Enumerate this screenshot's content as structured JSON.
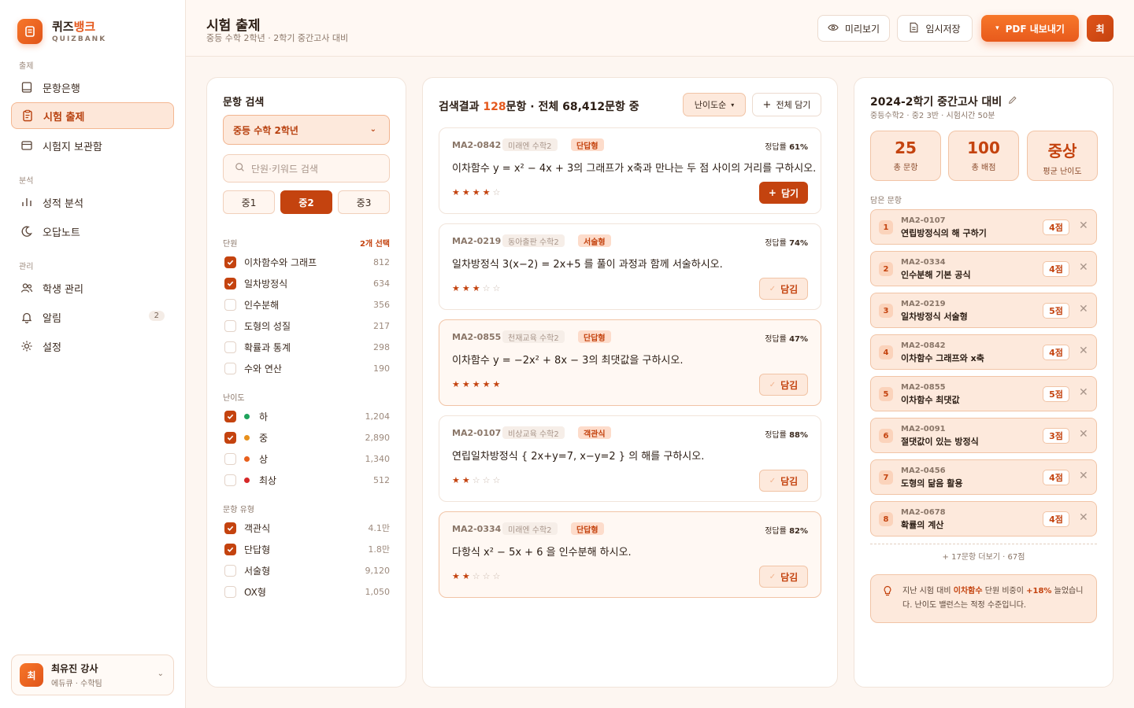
{
  "brand": {
    "name_prefix": "퀴즈",
    "name_accent": "뱅크",
    "sub": "QUIZBANK"
  },
  "sidebar": {
    "sections": {
      "create": "출제",
      "analysis": "분석",
      "manage": "관리"
    },
    "items": [
      {
        "label": "문항은행",
        "icon": "book-icon"
      },
      {
        "label": "시험 출제",
        "icon": "clipboard-icon"
      },
      {
        "label": "시험지 보관함",
        "icon": "archive-icon"
      },
      {
        "label": "성적 분석",
        "icon": "bar-chart-icon"
      },
      {
        "label": "오답노트",
        "icon": "moon-icon"
      },
      {
        "label": "학생 관리",
        "icon": "users-icon"
      },
      {
        "label": "알림",
        "icon": "bell-icon",
        "badge": "2"
      },
      {
        "label": "설정",
        "icon": "gear-icon"
      }
    ],
    "user": {
      "initial": "최",
      "name": "최유진 강사",
      "role": "에듀큐 · 수학팀"
    }
  },
  "header": {
    "title": "시험 출제",
    "subtitle": "중등 수학 2학년 · 2학기 중간고사 대비",
    "preview": "미리보기",
    "save": "임시저장",
    "export": "PDF 내보내기",
    "avatar": "최"
  },
  "search_panel": {
    "title": "문항 검색",
    "grade_select": "중등 수학 2학년",
    "search_placeholder": "단원·키워드 검색",
    "grades": [
      "중1",
      "중2",
      "중3"
    ],
    "active_grade": "중2",
    "units_label": "단원",
    "units_selected": "2개 선택",
    "units": [
      {
        "label": "이차함수와 그래프",
        "count": "812",
        "checked": true
      },
      {
        "label": "일차방정식",
        "count": "634",
        "checked": true
      },
      {
        "label": "인수분해",
        "count": "356",
        "checked": false
      },
      {
        "label": "도형의 성질",
        "count": "217",
        "checked": false
      },
      {
        "label": "확률과 통계",
        "count": "298",
        "checked": false
      },
      {
        "label": "수와 연산",
        "count": "190",
        "checked": false
      }
    ],
    "difficulty_label": "난이도",
    "difficulties": [
      {
        "label": "하",
        "count": "1,204",
        "checked": true,
        "color": "#1fa35c"
      },
      {
        "label": "중",
        "count": "2,890",
        "checked": true,
        "color": "#e8901c"
      },
      {
        "label": "상",
        "count": "1,340",
        "checked": false,
        "color": "#e8601c"
      },
      {
        "label": "최상",
        "count": "512",
        "checked": false,
        "color": "#d62828"
      }
    ],
    "type_label": "문항 유형",
    "types": [
      {
        "label": "객관식",
        "count": "4.1만",
        "checked": true
      },
      {
        "label": "단답형",
        "count": "1.8만",
        "checked": true
      },
      {
        "label": "서술형",
        "count": "9,120",
        "checked": false
      },
      {
        "label": "OX형",
        "count": "1,050",
        "checked": false
      }
    ]
  },
  "results": {
    "prefix": "검색결과 ",
    "count": "128",
    "suffix": "문항 · 전체 68,412문항 중",
    "sort_label": "난이도순",
    "add_all_label": "전체 담기",
    "rate_label": "정답률",
    "add_label": "담기",
    "added_label": "담김",
    "questions": [
      {
        "code": "MA2-0842",
        "publisher": "미래엔 수학2",
        "type": "단답형",
        "rate": "61%",
        "text": "이차함수 y = x² − 4x + 3의 그래프가 x축과 만나는 두 점 사이의 거리를 구하시오.",
        "stars": 4,
        "added": false
      },
      {
        "code": "MA2-0219",
        "publisher": "동아출판 수학2",
        "type": "서술형",
        "rate": "74%",
        "text": "일차방정식 3(x−2) = 2x+5 를 풀이 과정과 함께 서술하시오.",
        "stars": 3,
        "added": true
      },
      {
        "code": "MA2-0855",
        "publisher": "천재교육 수학2",
        "type": "단답형",
        "rate": "47%",
        "text": "이차함수 y = −2x² + 8x − 3의 최댓값을 구하시오.",
        "stars": 5,
        "added": true
      },
      {
        "code": "MA2-0107",
        "publisher": "비상교육 수학2",
        "type": "객관식",
        "rate": "88%",
        "text": "연립일차방정식 { 2x+y=7, x−y=2 } 의 해를 구하시오.",
        "stars": 2,
        "added": true
      },
      {
        "code": "MA2-0334",
        "publisher": "미래엔 수학2",
        "type": "단답형",
        "rate": "82%",
        "text": "다항식 x² − 5x + 6 을 인수분해 하시오.",
        "stars": 2,
        "added": true
      }
    ]
  },
  "exam": {
    "title": "2024-2학기 중간고사 대비",
    "subtitle": "중등수학2 · 중2 3반 · 시험시간 50분",
    "stats": [
      {
        "value": "25",
        "label": "총 문항"
      },
      {
        "value": "100",
        "label": "총 배점"
      },
      {
        "value": "중상",
        "label": "평균 난이도"
      }
    ],
    "picked_label": "담은 문항",
    "picked": [
      {
        "no": "1",
        "code": "MA2-0107",
        "name": "연립방정식의 해 구하기",
        "score": "4점"
      },
      {
        "no": "2",
        "code": "MA2-0334",
        "name": "인수분해 기본 공식",
        "score": "4점"
      },
      {
        "no": "3",
        "code": "MA2-0219",
        "name": "일차방정식 서술형",
        "score": "5점"
      },
      {
        "no": "4",
        "code": "MA2-0842",
        "name": "이차함수 그래프와 x축",
        "score": "4점"
      },
      {
        "no": "5",
        "code": "MA2-0855",
        "name": "이차함수 최댓값",
        "score": "5점"
      },
      {
        "no": "6",
        "code": "MA2-0091",
        "name": "절댓값이 있는 방정식",
        "score": "3점"
      },
      {
        "no": "7",
        "code": "MA2-0456",
        "name": "도형의 닮음 활용",
        "score": "4점"
      },
      {
        "no": "8",
        "code": "MA2-0678",
        "name": "확률의 계산",
        "score": "4점"
      }
    ],
    "more": "+ 17문항 더보기 · 67점",
    "tip": {
      "pre": "지난 시험 대비 ",
      "unit": "이차함수",
      "mid": " 단원 비중이 ",
      "pct": "+18%",
      "post": " 늘었습니다. 난이도 밸런스는 적정 수준입니다."
    }
  }
}
